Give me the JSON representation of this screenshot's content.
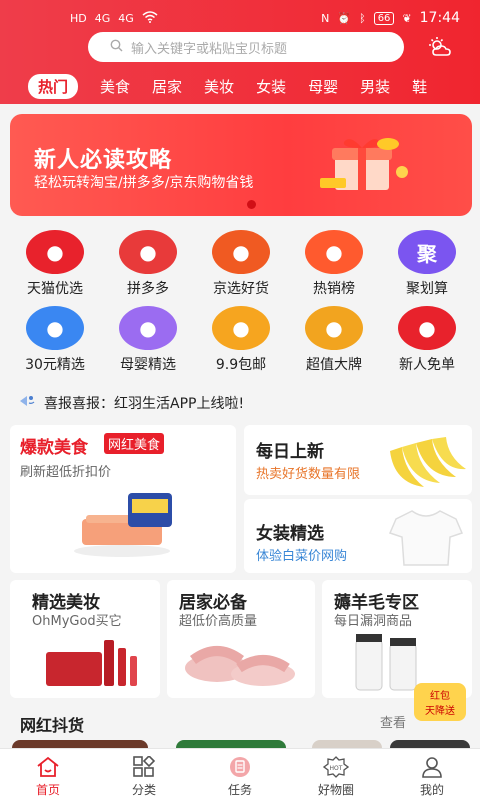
{
  "status": {
    "left": [
      "HD",
      "4G",
      "4G",
      "WiFi"
    ],
    "battery": "66",
    "time": "17:44"
  },
  "search": {
    "placeholder": "输入关键字或粘贴宝贝标题"
  },
  "categories": [
    "热门",
    "美食",
    "居家",
    "美妆",
    "女装",
    "母婴",
    "男装",
    "鞋"
  ],
  "banner": {
    "title": "新人必读攻略",
    "subtitle": "轻松玩转淘宝/拼多多/京东购物省钱"
  },
  "grid": [
    {
      "label": "天猫优选",
      "color": "#e8222c",
      "icon": "cat-face-icon"
    },
    {
      "label": "拼多多",
      "color": "#e83a3a",
      "icon": "heart-icon"
    },
    {
      "label": "京选好货",
      "color": "#f05a22",
      "icon": "dog-icon"
    },
    {
      "label": "热销榜",
      "color": "#ff5a2e",
      "icon": "flame-icon"
    },
    {
      "label": "聚划算",
      "color": "#7b55f0",
      "icon": "ju-icon",
      "glyph": "聚"
    },
    {
      "label": "30元精选",
      "color": "#3a87f2",
      "icon": "diamond-icon"
    },
    {
      "label": "母婴精选",
      "color": "#9b6cf1",
      "icon": "baby-icon"
    },
    {
      "label": "9.9包邮",
      "color": "#f6a51f",
      "icon": "ticket-icon"
    },
    {
      "label": "超值大牌",
      "color": "#f2a41f",
      "icon": "crown-icon"
    },
    {
      "label": "新人免单",
      "color": "#e8222c",
      "icon": "gift-icon"
    }
  ],
  "notice": {
    "text": "喜报喜报：红羽生活APP上线啦!"
  },
  "cards": {
    "food": {
      "title": "爆款美食",
      "tag": "网红美食",
      "sub": "刷新超低折扣价"
    },
    "daily": {
      "title": "每日上新",
      "sub": "热卖好货数量有限"
    },
    "women": {
      "title": "女装精选",
      "sub": "体验白菜价网购"
    },
    "beauty": {
      "title": "精选美妆",
      "sub": "OhMyGod买它"
    },
    "home": {
      "title": "居家必备",
      "sub": "超低价高质量"
    },
    "wool": {
      "title": "薅羊毛专区",
      "sub": "每日漏洞商品"
    }
  },
  "promo": {
    "line1": "红包",
    "line2": "天降送"
  },
  "section": {
    "title": "网红抖货",
    "more": "查看"
  },
  "tabs": [
    {
      "label": "首页",
      "icon": "home-icon"
    },
    {
      "label": "分类",
      "icon": "category-icon"
    },
    {
      "label": "任务",
      "icon": "task-icon"
    },
    {
      "label": "好物圈",
      "icon": "hot-icon"
    },
    {
      "label": "我的",
      "icon": "user-icon"
    }
  ],
  "colors": {
    "brand": "#e8202b",
    "header": "#ef2a34",
    "orange_text": "#e8752a",
    "blue_text": "#3a87d6"
  }
}
